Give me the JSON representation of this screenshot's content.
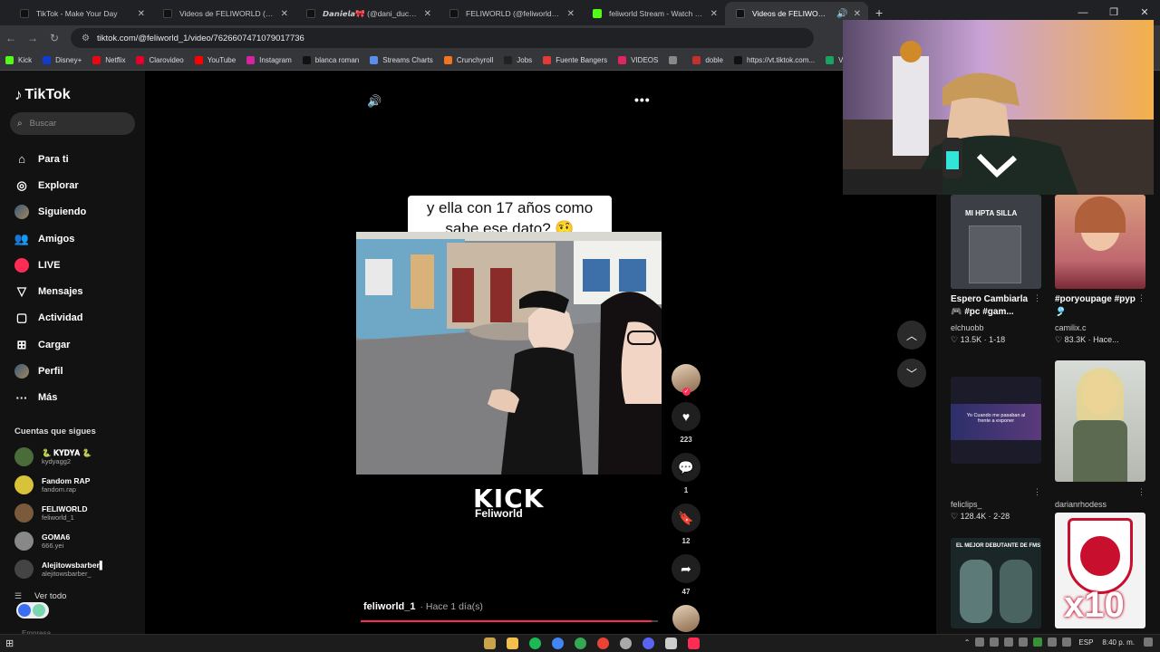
{
  "colors": {
    "accent": "#fe2c55",
    "background": "#121212",
    "video_bg": "#000000"
  },
  "tabs": [
    {
      "label": "TikTok - Make Your Day",
      "icon": "tiktok-icon",
      "active": false
    },
    {
      "label": "Videos de FELIWORLD (@feliw",
      "icon": "tiktok-icon",
      "active": false
    },
    {
      "label": "𝘿𝙖𝙣𝙞𝙚𝙡𝙖🎀 (@dani_ducuara0",
      "icon": "tiktok-icon",
      "active": false
    },
    {
      "label": "FELIWORLD (@feliworld_1) | Ti",
      "icon": "tiktok-icon",
      "active": false
    },
    {
      "label": "feliworld Stream - Watch Live o",
      "icon": "kick-icon",
      "active": false
    },
    {
      "label": "Videos de FELIWORLD (@fe",
      "icon": "tiktok-icon",
      "active": true
    }
  ],
  "address": {
    "url": "tiktok.com/@feliworld_1/video/7626607471079017736"
  },
  "bookmarks": [
    {
      "label": "Kick",
      "color": "#53fc18"
    },
    {
      "label": "Disney+",
      "color": "#113ccf"
    },
    {
      "label": "Netflix",
      "color": "#e50914"
    },
    {
      "label": "Clarovideo",
      "color": "#e4002b"
    },
    {
      "label": "YouTube",
      "color": "#ff0000"
    },
    {
      "label": "Instagram",
      "color": "#d6249f"
    },
    {
      "label": "blanca roman",
      "color": "#111111"
    },
    {
      "label": "Streams Charts",
      "color": "#5b8def"
    },
    {
      "label": "Crunchyroll",
      "color": "#f47521"
    },
    {
      "label": "Jobs",
      "color": "#222222"
    },
    {
      "label": "Fuente Bangers",
      "color": "#e03a3a"
    },
    {
      "label": "VIDEOS",
      "color": "#e0245e"
    },
    {
      "label": "",
      "color": "#888888"
    },
    {
      "label": "doble",
      "color": "#c4302b"
    },
    {
      "label": "https://vt.tiktok.com...",
      "color": "#111111"
    },
    {
      "label": "Ver Pa",
      "color": "#1aa260"
    }
  ],
  "sidebar": {
    "logo": "TikTok",
    "search_placeholder": "Buscar",
    "nav": [
      {
        "label": "Para ti",
        "icon": "home-icon"
      },
      {
        "label": "Explorar",
        "icon": "compass-icon"
      },
      {
        "label": "Siguiendo",
        "icon": "following-avatar-icon"
      },
      {
        "label": "Amigos",
        "icon": "friends-icon"
      },
      {
        "label": "LIVE",
        "icon": "live-icon"
      },
      {
        "label": "Mensajes",
        "icon": "messages-icon"
      },
      {
        "label": "Actividad",
        "icon": "activity-icon"
      },
      {
        "label": "Cargar",
        "icon": "upload-icon"
      },
      {
        "label": "Perfil",
        "icon": "profile-icon"
      },
      {
        "label": "Más",
        "icon": "more-icon"
      }
    ],
    "following_header": "Cuentas que sigues",
    "following": [
      {
        "name": "🐍 𝐊𝐘𝐃𝐘𝐀 🐍",
        "handle": "kydyagg2"
      },
      {
        "name": "Fandom RAP",
        "handle": "fandom.rap"
      },
      {
        "name": "FELIWORLD",
        "handle": "feliworld_1"
      },
      {
        "name": "GOMA6",
        "handle": "666.yei"
      },
      {
        "name": "Alejitowsbarber▌",
        "handle": "alejitowsbarber_"
      }
    ],
    "see_all": "Ver todo",
    "footer": "Empresa"
  },
  "video": {
    "caption": "y ella con 17 años como sabe ese dato? 🤨",
    "watermark_brand": "KICK",
    "watermark_name": "Feliworld",
    "author": "feliworld_1",
    "time": "· Hace 1 día(s)",
    "progress": 0.98,
    "likes": "223",
    "comments": "1",
    "saves": "12",
    "shares": "47"
  },
  "grid": [
    {
      "title": "Espero Cambiarla 🎮 #pc #gam...",
      "user": "elchuobb",
      "likes": "13.5K",
      "meta": "1-18",
      "thumb_text": "MI HPTA SILLA"
    },
    {
      "title": "#poryoupage #pyp🎐",
      "user": "camilix.c",
      "likes": "83.3K",
      "meta": "Hace...",
      "thumb_text": ""
    },
    {
      "title": "",
      "user": "feliclips_",
      "likes": "128.4K",
      "meta": "2-28",
      "thumb_text": "Yo Cuando me pasaban al frente a exponer"
    },
    {
      "title": "",
      "user": "darianrhodess",
      "likes": "",
      "meta": "",
      "thumb_text": ""
    },
    {
      "title": "",
      "user": "",
      "likes": "",
      "meta": "",
      "thumb_text": "EL MEJOR DEBUTANTE DE FMS"
    },
    {
      "title": "",
      "user": "",
      "likes": "",
      "meta": "",
      "thumb_text": "x10"
    }
  ],
  "taskbar": {
    "lang": "ESP",
    "time": "8:40 p. m."
  }
}
